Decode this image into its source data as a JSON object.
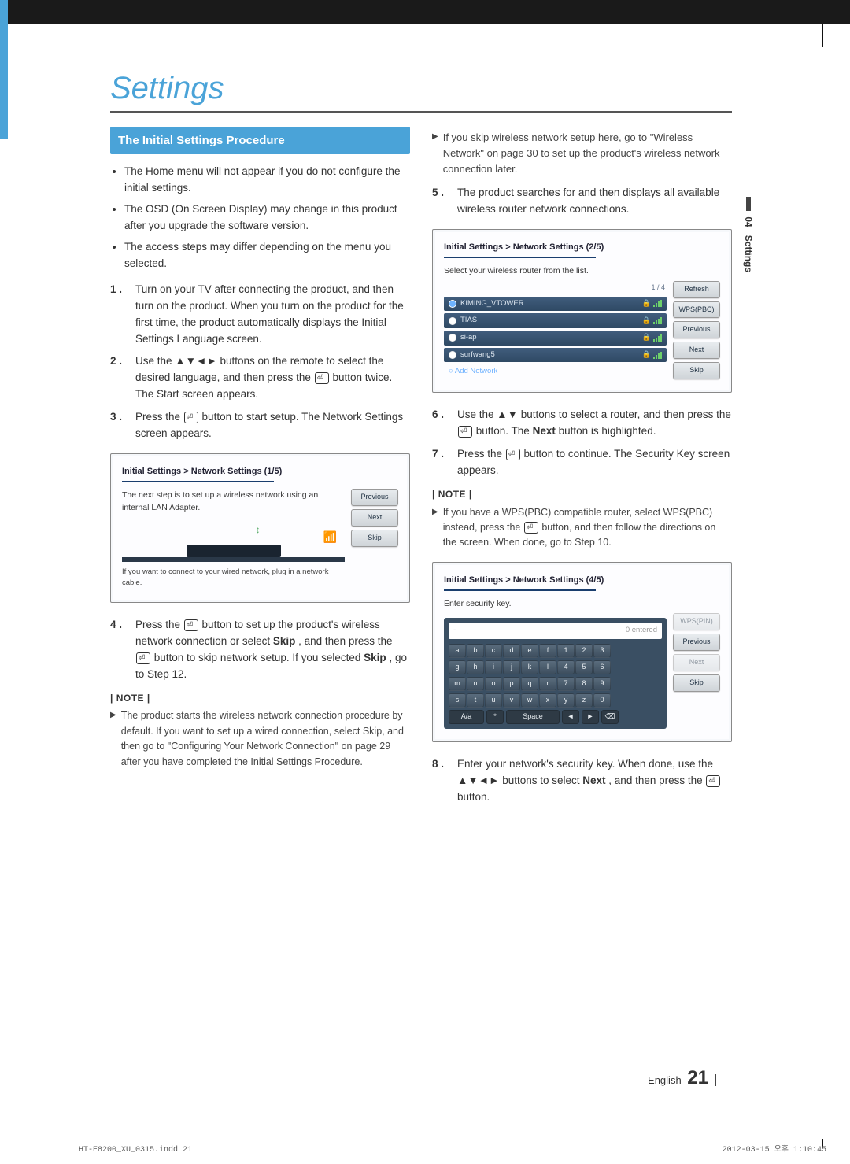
{
  "title": "Settings",
  "section_head": "The Initial Settings Procedure",
  "sidetab": {
    "num": "04",
    "label": "Settings"
  },
  "intro_bullets": [
    "The Home menu will not appear if you do not configure the initial settings.",
    "The OSD (On Screen Display) may change in this product after you upgrade the software version.",
    "The access steps may differ depending on the menu you selected."
  ],
  "steps_left": [
    {
      "n": "1 .",
      "t": "Turn on your TV after connecting the product, and then turn on the product. When you turn on the product for the first time, the product automatically displays the Initial Settings Language screen."
    },
    {
      "n": "2 .",
      "t_pre": "Use the ▲▼◄► buttons on the remote to select the desired language, and then press the ",
      "t_post": " button twice. The Start screen appears."
    },
    {
      "n": "3 .",
      "t_pre": "Press the ",
      "t_post": " button to start setup. The Network Settings screen appears."
    },
    {
      "n": "4 .",
      "t_pre": "Press the ",
      "t_mid": " button to set up the product's wireless network connection or select ",
      "skip1": "Skip",
      "t_mid2": ", and then press the ",
      "t_post": " button to skip network setup. If you selected ",
      "skip2": "Skip",
      "t_end": ", go to Step 12."
    }
  ],
  "note_label": "| NOTE |",
  "note_left": "The product starts the wireless network connection procedure by default. If you want to set up a wired connection, select Skip, and then go to \"Configuring Your Network Connection\" on page 29 after you have completed the Initial Settings Procedure.",
  "note_right_top": "If you skip wireless network setup here, go to \"Wireless Network\" on page 30 to set up the product's wireless network connection later.",
  "steps_right": [
    {
      "n": "5 .",
      "t": "The product searches for and then displays all available wireless router network connections."
    },
    {
      "n": "6 .",
      "t_pre": "Use the ▲▼ buttons to select a router, and then press the ",
      "t_post": " button. The ",
      "next": "Next",
      "t_end": " button is highlighted."
    },
    {
      "n": "7 .",
      "t_pre": "Press the ",
      "t_post": " button to continue. The Security Key screen appears."
    },
    {
      "n": "8 .",
      "t_pre": "Enter your network's security key. When done, use the ▲▼◄► buttons to select ",
      "next": "Next",
      "t_mid": ", and then press the ",
      "t_end": " button."
    }
  ],
  "note_right_mid": "If you have a WPS(PBC) compatible router, select WPS(PBC) instead, press the  button, and then follow the directions on the screen. When done, go to Step 10.",
  "osd1": {
    "crumb": "Initial Settings > Network Settings (1/5)",
    "line1": "The next step is to set up a wireless network using an internal LAN Adapter.",
    "line2": "If you want to connect to your wired network, plug in a network cable.",
    "buttons": [
      "Previous",
      "Next",
      "Skip"
    ]
  },
  "osd2": {
    "crumb": "Initial Settings > Network Settings (2/5)",
    "prompt": "Select your wireless router from the list.",
    "count": "1 / 4",
    "routers": [
      "KIMING_VTOWER",
      "TIAS",
      "si-ap",
      "surfwang5"
    ],
    "add": "Add Network",
    "buttons": [
      "Refresh",
      "WPS(PBC)",
      "Previous",
      "Next",
      "Skip"
    ]
  },
  "osd3": {
    "crumb": "Initial Settings > Network Settings (4/5)",
    "prompt": "Enter security key.",
    "entered": "0 entered",
    "dash": "-",
    "keys_rows": [
      [
        "a",
        "b",
        "c",
        "d",
        "e",
        "f",
        "1",
        "2",
        "3"
      ],
      [
        "g",
        "h",
        "i",
        "j",
        "k",
        "l",
        "4",
        "5",
        "6"
      ],
      [
        "m",
        "n",
        "o",
        "p",
        "q",
        "r",
        "7",
        "8",
        "9"
      ],
      [
        "s",
        "t",
        "u",
        "v",
        "w",
        "x",
        "y",
        "z",
        "0"
      ]
    ],
    "bottom_keys": {
      "aa": "A/a",
      "star": "*",
      "space": "Space",
      "left": "◄",
      "right": "►",
      "del": "⌫"
    },
    "buttons": [
      "WPS(PIN)",
      "Previous",
      "Next",
      "Skip"
    ]
  },
  "footer": {
    "lang": "English",
    "page": "21"
  },
  "print": {
    "left": "HT-E8200_XU_0315.indd   21",
    "right": "2012-03-15   오후 1:10:45"
  }
}
